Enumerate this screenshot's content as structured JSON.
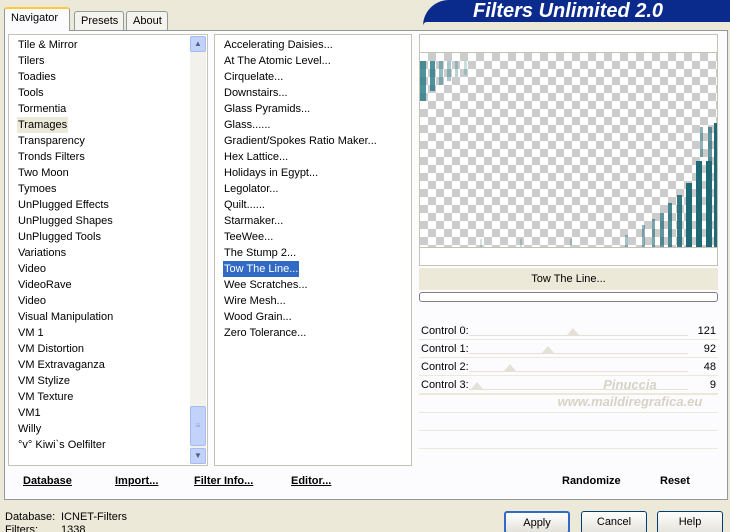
{
  "tabs": [
    {
      "label": "Navigator",
      "active": true
    },
    {
      "label": "Presets",
      "active": false
    },
    {
      "label": "About",
      "active": false
    }
  ],
  "banner_title": "Filters Unlimited 2.0",
  "categories": [
    "Tile & Mirror",
    "Tilers",
    "Toadies",
    "Tools",
    "Tormentia",
    "Tramages",
    "Transparency",
    "Tronds Filters",
    "Two Moon",
    "Tymoes",
    "UnPlugged Effects",
    "UnPlugged Shapes",
    "UnPlugged Tools",
    "Variations",
    "Video",
    "VideoRave",
    "Video",
    "Visual Manipulation",
    "VM 1",
    "VM Distortion",
    "VM Extravaganza",
    "VM Stylize",
    "VM Texture",
    "VM1",
    "Willy",
    "°v° Kiwi`s Oelfilter"
  ],
  "selected_category": "Tramages",
  "filters": [
    "Accelerating Daisies...",
    "At The Atomic Level...",
    "Cirquelate...",
    "Downstairs...",
    "Glass Pyramids...",
    "Glass......",
    "Gradient/Spokes Ratio Maker...",
    "Hex Lattice...",
    "Holidays in Egypt...",
    "Legolator...",
    "Quilt......",
    "Starmaker...",
    "TeeWee...",
    "The Stump 2...",
    "Tow The Line...",
    "Wee Scratches...",
    "Wire Mesh...",
    "Wood Grain...",
    "Zero Tolerance..."
  ],
  "selected_filter": "Tow The Line...",
  "left_links": {
    "database": "Database",
    "import": "Import...",
    "filter_info": "Filter Info...",
    "editor": "Editor..."
  },
  "preview_filter_name": "Tow The Line...",
  "controls": [
    {
      "label": "Control 0:",
      "value": "121",
      "level": 0.474
    },
    {
      "label": "Control 1:",
      "value": "92",
      "level": 0.361
    },
    {
      "label": "Control 2:",
      "value": "48",
      "level": 0.188
    },
    {
      "label": "Control 3:",
      "value": "9",
      "level": 0.035
    }
  ],
  "watermark": [
    "Pinuccia",
    "www.maildiregrafica.eu"
  ],
  "right_buttons": {
    "randomize": "Randomize",
    "reset": "Reset"
  },
  "status": {
    "database_label": "Database:",
    "database_value": "ICNET-Filters",
    "filters_label": "Filters:",
    "filters_value": "1338"
  },
  "dialog_buttons": {
    "apply": "Apply",
    "cancel": "Cancel",
    "help": "Help"
  },
  "colors": {
    "selection": "#316ac5",
    "banner": "#0a2a8c",
    "preview_teal": "#2f7f8a"
  }
}
